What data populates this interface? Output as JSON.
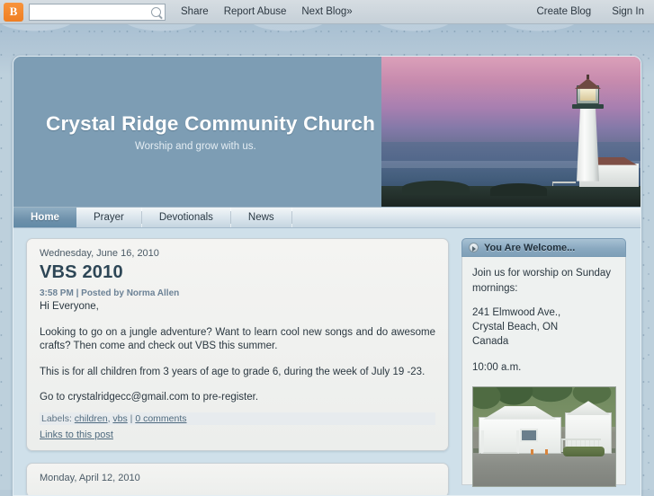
{
  "navbar": {
    "logo_label": "B",
    "search_placeholder": "",
    "search_value": "",
    "share_label": "Share",
    "report_abuse_label": "Report Abuse",
    "next_blog_label": "Next Blog»",
    "create_blog_label": "Create Blog",
    "sign_in_label": "Sign In"
  },
  "header": {
    "title": "Crystal Ridge Community Church",
    "description": "Worship and grow with us."
  },
  "tabs": [
    {
      "label": "Home",
      "active": true
    },
    {
      "label": "Prayer",
      "active": false
    },
    {
      "label": "Devotionals",
      "active": false
    },
    {
      "label": "News",
      "active": false
    }
  ],
  "posts": [
    {
      "date": "Wednesday, June 16, 2010",
      "title": "VBS 2010",
      "meta": "3:58 PM | Posted by Norma Allen",
      "body": [
        "Hi Everyone,",
        "Looking to go on a jungle adventure? Want to learn cool new songs and do awesome crafts? Then come and check out VBS this summer.",
        "This is for all children from 3 years of age to grade 6, during the week of July 19 -23.",
        "Go to crystalridgecc@gmail.com to pre-register."
      ],
      "labels_prefix": "Labels:",
      "label_links": [
        "children",
        "vbs"
      ],
      "comments_label": "0 comments",
      "links_to_post_label": "Links to this post"
    },
    {
      "date": "Monday, April 12, 2010"
    }
  ],
  "sidebar": {
    "heading": "You Are Welcome...",
    "intro": "Join us for worship on Sunday mornings:",
    "address": "241 Elmwood Ave.,\nCrystal Beach, ON\nCanada",
    "time": "10:00 a.m.",
    "photo_name": "church-building-photo"
  },
  "colors": {
    "brand_orange": "#ef7f23",
    "header_blue": "#7d9db4",
    "active_tab": "#6e91ab",
    "page_bg": "#b4c8d7",
    "link": "#4f6a7e"
  }
}
